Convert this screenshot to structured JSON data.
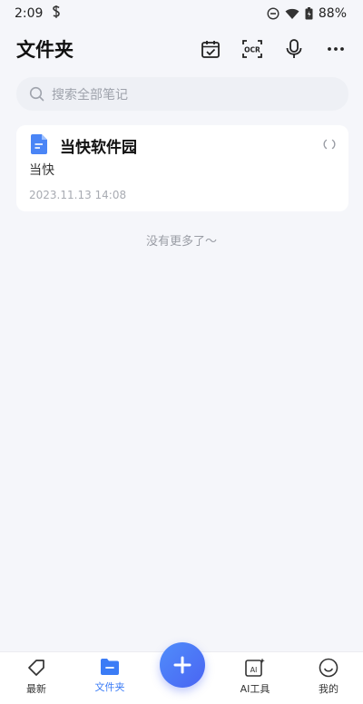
{
  "status": {
    "time": "2:09",
    "battery": "88%"
  },
  "header": {
    "title": "文件夹",
    "ocr_label": "OCR"
  },
  "search": {
    "placeholder": "搜索全部笔记"
  },
  "notes": [
    {
      "title": "当快软件园",
      "preview": "当快",
      "date": "2023.11.13 14:08"
    }
  ],
  "list_end_text": "没有更多了～",
  "bottom_nav": {
    "items": [
      {
        "label": "最新",
        "icon": "tag-icon",
        "active": false
      },
      {
        "label": "文件夹",
        "icon": "folder-icon",
        "active": true
      },
      {
        "label": "AI工具",
        "icon": "ai-tool-icon",
        "active": false
      },
      {
        "label": "我的",
        "icon": "smile-icon",
        "active": false
      }
    ],
    "fab_icon": "plus-icon"
  },
  "colors": {
    "accent": "#3b7cf6",
    "background": "#f5f6fa",
    "fab_gradient_start": "#4f8dfb",
    "fab_gradient_end": "#4a64f2"
  }
}
